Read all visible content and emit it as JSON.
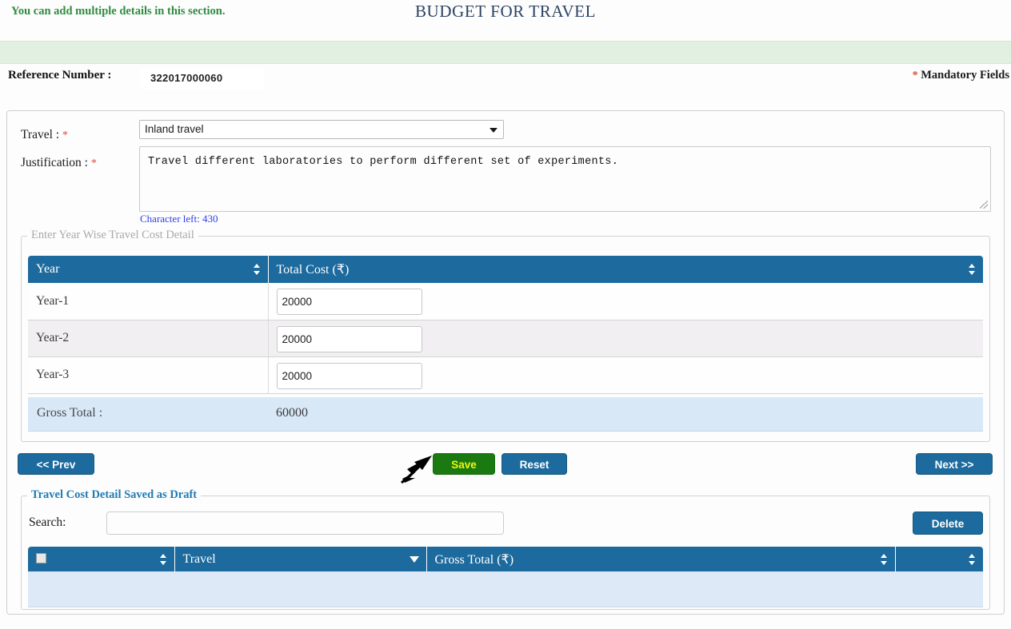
{
  "page": {
    "title": "BUDGET FOR TRAVEL",
    "alert": "You can add multiple details in this section.",
    "reference_label": "Reference Number :",
    "reference_value": "322017000060",
    "mandatory_star": "*",
    "mandatory_text": "Mandatory Fields"
  },
  "form": {
    "travel_label": "Travel :",
    "travel_value": "Inland travel",
    "justification_label": "Justification :",
    "justification_value": "Travel different laboratories to perform different set of experiments.",
    "character_left": "Character left: 430"
  },
  "year_section": {
    "legend": "Enter Year Wise Travel Cost Detail",
    "columns": [
      "Year",
      "Total Cost (₹)"
    ],
    "rows": [
      {
        "year": "Year-1",
        "cost": "20000"
      },
      {
        "year": "Year-2",
        "cost": "20000"
      },
      {
        "year": "Year-3",
        "cost": "20000"
      }
    ],
    "gross_total_label": "Gross Total :",
    "gross_total_value": "60000"
  },
  "buttons": {
    "prev": "<< Prev",
    "save": "Save",
    "reset": "Reset",
    "next": "Next >>",
    "delete": "Delete"
  },
  "draft_section": {
    "legend": "Travel Cost Detail Saved as Draft",
    "search_label": "Search:",
    "search_value": "",
    "search_placeholder": "",
    "columns": [
      "",
      "Travel",
      "Gross Total (₹)",
      ""
    ],
    "rows": []
  },
  "colors": {
    "header_blue": "#1c6a9e",
    "save_green": "#1a7a11",
    "save_text_yellow": "#f2f60c",
    "alert_green_bg": "#e2f0e2",
    "alert_green_text": "#2e8b40",
    "link_blue": "#2b3ee8",
    "legend_blue": "#1f7bb6",
    "star_red": "#e04a30",
    "gross_row_blue": "#d8e8f7"
  }
}
